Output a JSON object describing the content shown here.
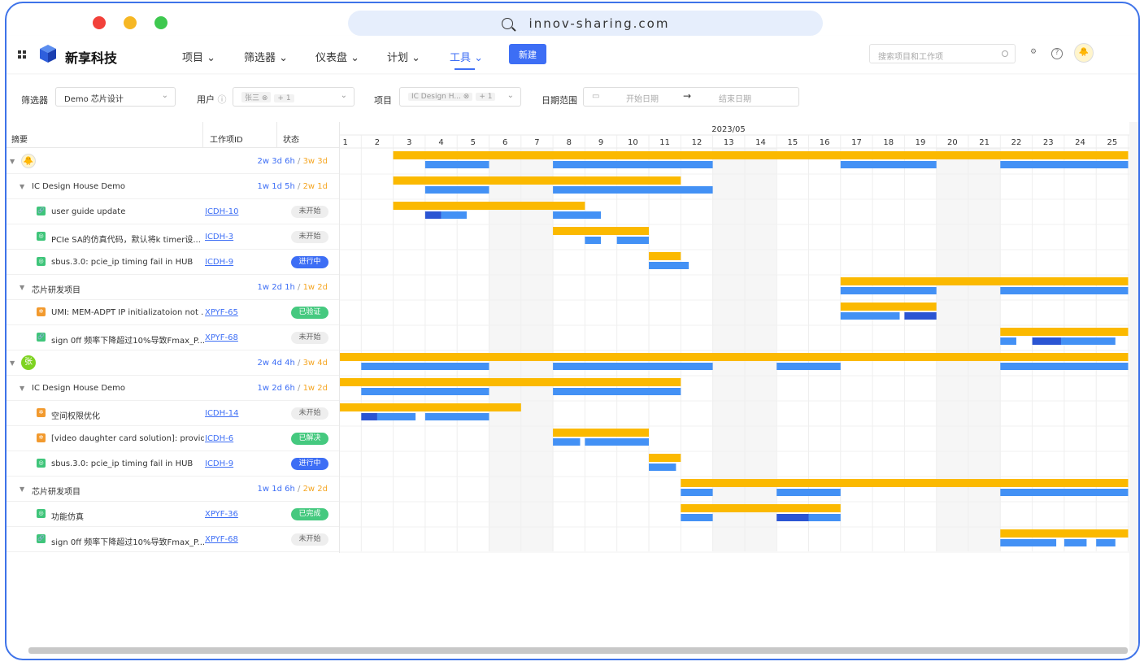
{
  "browser": {
    "url": "innov-sharing.com"
  },
  "brand": {
    "name": "新享科技"
  },
  "nav": [
    {
      "label": "项目"
    },
    {
      "label": "筛选器"
    },
    {
      "label": "仪表盘"
    },
    {
      "label": "计划"
    },
    {
      "label": "工具"
    }
  ],
  "new_button": "新建",
  "search_placeholder": "搜索项目和工作项",
  "filters": {
    "filter_label": "筛选器",
    "filter_value": "Demo 芯片设计",
    "user_label": "用户",
    "user_tag": "张三",
    "user_more": "+ 1",
    "project_label": "项目",
    "project_tag": "IC Design H...",
    "project_more": "+ 1",
    "date_label": "日期范围",
    "date_start": "开始日期",
    "date_arrow": "→",
    "date_end": "结束日期"
  },
  "columns": {
    "summary": "摘要",
    "id": "工作项ID",
    "status": "状态"
  },
  "timeline": {
    "month": "2023/05",
    "days": [
      "1",
      "2",
      "3",
      "4",
      "5",
      "6",
      "7",
      "8",
      "9",
      "10",
      "11",
      "12",
      "13",
      "14",
      "15",
      "16",
      "17",
      "18",
      "19",
      "20",
      "21",
      "22",
      "23",
      "24",
      "25"
    ]
  },
  "rows": [
    {
      "kind": "user",
      "avatar": "",
      "est": "2w 3d 6h",
      "sep": " / ",
      "act": "3w 3d"
    },
    {
      "kind": "project",
      "title": "IC Design House Demo",
      "est": "1w 1d 5h",
      "sep": " / ",
      "act": "2w 1d"
    },
    {
      "kind": "task",
      "icon": "story",
      "title": "user guide update",
      "id": "ICDH-10",
      "status": "未开始"
    },
    {
      "kind": "task",
      "icon": "task",
      "title": "PCIe SA的仿真代码，默认将k timer设...",
      "id": "ICDH-3",
      "status": "未开始"
    },
    {
      "kind": "task",
      "icon": "task",
      "title": "sbus.3.0: pcie_ip timing fail in HUB",
      "id": "ICDH-9",
      "status": "进行中"
    },
    {
      "kind": "project",
      "title": "芯片研发项目",
      "est": "1w 2d 1h",
      "sep": " / ",
      "act": "1w 2d"
    },
    {
      "kind": "task",
      "icon": "bug",
      "title": "UMI: MEM-ADPT IP initializatoion not ...",
      "id": "XPYF-65",
      "status": "已验证"
    },
    {
      "kind": "task",
      "icon": "story",
      "title": "sign 0ff 频率下降超过10%导致Fmax_P...",
      "id": "XPYF-68",
      "status": "未开始"
    },
    {
      "kind": "user",
      "avatar": "张",
      "est": "2w 4d 4h",
      "sep": " / ",
      "act": "3w 4d"
    },
    {
      "kind": "project",
      "title": "IC Design House Demo",
      "est": "1w 2d 6h",
      "sep": " / ",
      "act": "1w 2d"
    },
    {
      "kind": "task",
      "icon": "bug",
      "title": "空间权限优化",
      "id": "ICDH-14",
      "status": "未开始"
    },
    {
      "kind": "task",
      "icon": "bug",
      "title": "[video daughter card solution]: provid...",
      "id": "ICDH-6",
      "status": "已解决"
    },
    {
      "kind": "task",
      "icon": "task",
      "title": "sbus.3.0: pcie_ip timing fail in HUB",
      "id": "ICDH-9",
      "status": "进行中"
    },
    {
      "kind": "project",
      "title": "芯片研发项目",
      "est": "1w 1d 6h",
      "sep": " / ",
      "act": "2w 2d"
    },
    {
      "kind": "task",
      "icon": "task",
      "title": "功能仿真",
      "id": "XPYF-36",
      "status": "已完成"
    },
    {
      "kind": "task",
      "icon": "story",
      "title": "sign 0ff 频率下降超过10%导致Fmax_P...",
      "id": "XPYF-68",
      "status": "未开始"
    }
  ],
  "colors": {
    "planned": "#fbb900",
    "actual": "#4391f5",
    "actual_dark": "#2b55d3",
    "weekend": "#f6f6f6",
    "accent": "#3d6ef5"
  },
  "bars": [
    {
      "row": 0,
      "plan": [
        [
          3,
          25
        ]
      ],
      "act": [
        [
          4,
          5
        ],
        [
          8,
          12
        ],
        [
          17,
          19
        ],
        [
          22,
          25
        ]
      ]
    },
    {
      "row": 1,
      "plan": [
        [
          3,
          11
        ]
      ],
      "act": [
        [
          4,
          5
        ],
        [
          8,
          12
        ]
      ]
    },
    {
      "row": 2,
      "plan": [
        [
          3,
          8
        ]
      ],
      "act": [
        [
          4,
          4.5,
          "d"
        ],
        [
          4.5,
          5.3
        ],
        [
          8,
          9.5
        ]
      ]
    },
    {
      "row": 3,
      "plan": [
        [
          8,
          10
        ]
      ],
      "act": [
        [
          9,
          9.5
        ],
        [
          10,
          10
        ]
      ]
    },
    {
      "row": 4,
      "plan": [
        [
          11,
          11
        ]
      ],
      "act": [
        [
          11,
          12.25
        ]
      ]
    },
    {
      "row": 5,
      "plan": [
        [
          17,
          25
        ]
      ],
      "act": [
        [
          17,
          19
        ],
        [
          22,
          25
        ]
      ]
    },
    {
      "row": 6,
      "plan": [
        [
          17,
          19
        ]
      ],
      "act": [
        [
          17,
          18.85
        ],
        [
          19,
          19,
          "d"
        ]
      ]
    },
    {
      "row": 7,
      "plan": [
        [
          22,
          25
        ]
      ],
      "act": [
        [
          22,
          22.5
        ],
        [
          23,
          23.9,
          "d"
        ],
        [
          23.9,
          25.6
        ]
      ]
    },
    {
      "row": 8,
      "plan": [
        [
          1,
          25
        ]
      ],
      "act": [
        [
          2,
          5
        ],
        [
          8,
          12
        ],
        [
          15,
          16
        ],
        [
          22,
          25
        ]
      ]
    },
    {
      "row": 9,
      "plan": [
        [
          1,
          11
        ]
      ],
      "act": [
        [
          2,
          5
        ],
        [
          8,
          11
        ]
      ]
    },
    {
      "row": 10,
      "plan": [
        [
          1,
          6
        ]
      ],
      "act": [
        [
          2,
          2.5,
          "d"
        ],
        [
          2.5,
          3.7
        ],
        [
          4,
          5
        ]
      ]
    },
    {
      "row": 11,
      "plan": [
        [
          8,
          10
        ]
      ],
      "act": [
        [
          8,
          8.85
        ],
        [
          9,
          10
        ]
      ]
    },
    {
      "row": 12,
      "plan": [
        [
          11,
          11
        ]
      ],
      "act": [
        [
          11,
          11.85
        ]
      ]
    },
    {
      "row": 13,
      "plan": [
        [
          12,
          25
        ]
      ],
      "act": [
        [
          12,
          12
        ],
        [
          15,
          16
        ],
        [
          22,
          25
        ]
      ]
    },
    {
      "row": 14,
      "plan": [
        [
          12,
          16
        ]
      ],
      "act": [
        [
          12,
          12
        ],
        [
          15,
          15,
          "d"
        ],
        [
          16,
          16
        ]
      ]
    },
    {
      "row": 15,
      "plan": [
        [
          22,
          25
        ]
      ],
      "act": [
        [
          22,
          23.75
        ],
        [
          24,
          24.7
        ],
        [
          25,
          25.6
        ]
      ]
    }
  ],
  "weekends": [
    "6",
    "7",
    "13",
    "14",
    "20",
    "21"
  ]
}
